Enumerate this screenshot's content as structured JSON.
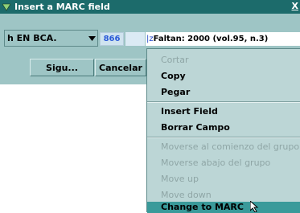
{
  "window": {
    "title": "Insert a MARC field",
    "close_label": "X"
  },
  "combo": {
    "value": "h  EN BCA."
  },
  "field": {
    "tag": "866",
    "subfield_code": "|z",
    "content": "Faltan: 2000 (vol.95, n.3)"
  },
  "buttons": {
    "next": "Sigu...",
    "cancel": "Cancelar"
  },
  "menu": {
    "items": [
      {
        "label": "Cortar",
        "enabled": false
      },
      {
        "label": "Copy",
        "enabled": true
      },
      {
        "label": "Pegar",
        "enabled": true
      },
      {
        "label": "Insert Field",
        "enabled": true
      },
      {
        "label": "Borrar Campo",
        "enabled": true
      },
      {
        "label": "Moverse al comienzo del grupo",
        "enabled": false
      },
      {
        "label": "Moverse abajo del grupo",
        "enabled": false
      },
      {
        "label": "Move up",
        "enabled": false
      },
      {
        "label": "Move down",
        "enabled": false
      },
      {
        "label": "Change to MARC",
        "enabled": true,
        "highlighted": true
      }
    ]
  },
  "colors": {
    "titlebar": "#1c6b6b",
    "dialog_bg": "#9ec5c5",
    "menu_bg": "#bcd6d6",
    "highlight": "#3a9a9a"
  }
}
